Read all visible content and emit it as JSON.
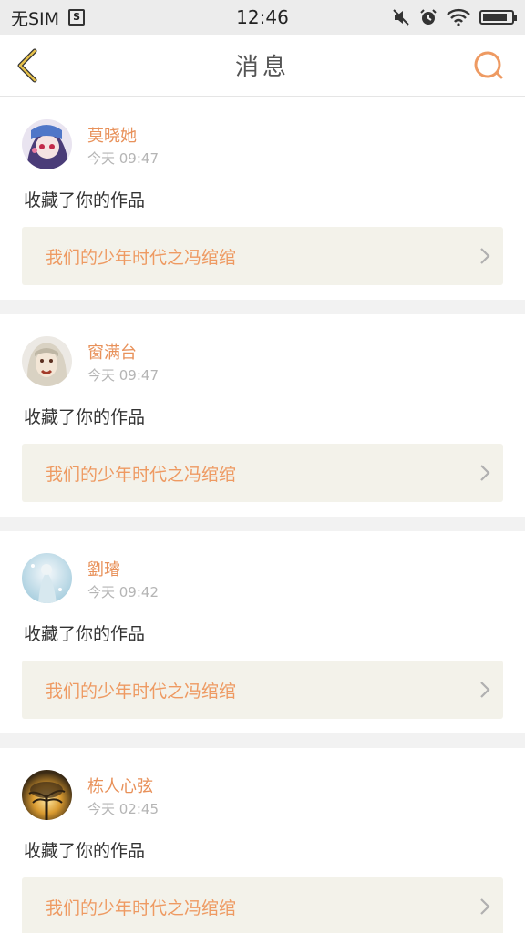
{
  "status_bar": {
    "carrier": "无SIM",
    "time": "12:46"
  },
  "header": {
    "title": "消息",
    "back_icon": "chevron-left-icon",
    "search_icon": "search-icon"
  },
  "colors": {
    "accent": "#e8915a",
    "back_icon": "#e5c04a",
    "card_link_bg": "#f3f2ea"
  },
  "messages": [
    {
      "user": "莫晓她",
      "time": "今天 09:47",
      "action": "收藏了你的作品",
      "work": "我们的少年时代之冯绾绾"
    },
    {
      "user": "窗满台",
      "time": "今天 09:47",
      "action": "收藏了你的作品",
      "work": "我们的少年时代之冯绾绾"
    },
    {
      "user": "劉璿",
      "time": "今天 09:42",
      "action": "收藏了你的作品",
      "work": "我们的少年时代之冯绾绾"
    },
    {
      "user": "栋人心弦",
      "time": "今天 02:45",
      "action": "收藏了你的作品",
      "work": "我们的少年时代之冯绾绾"
    }
  ]
}
